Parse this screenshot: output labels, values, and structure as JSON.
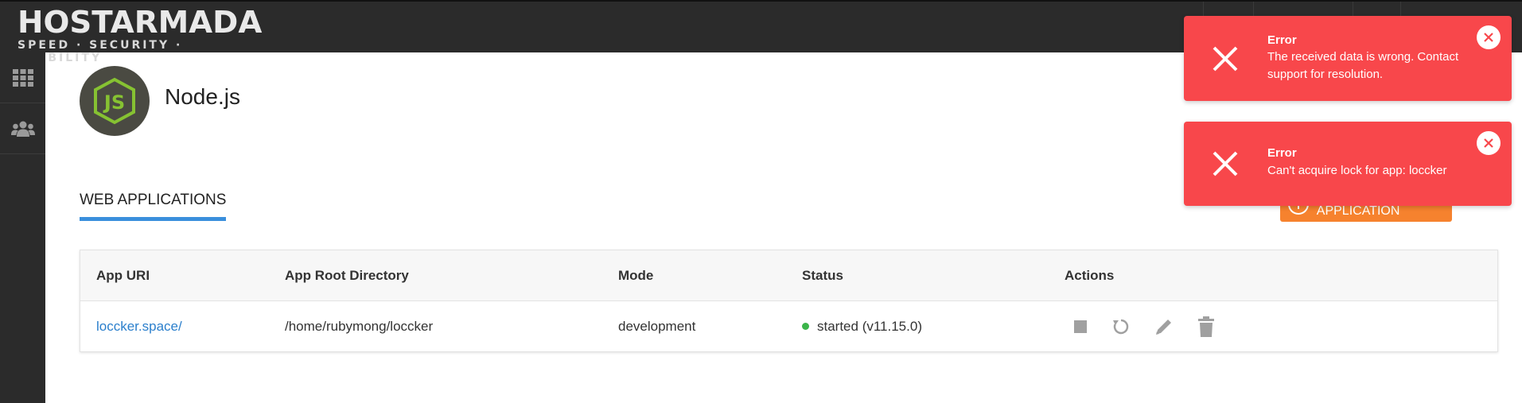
{
  "header": {
    "logo_main": "HOSTARMADA",
    "logo_sub": "SPEED · SECURITY · STABILITY"
  },
  "sidebar": {
    "items": [
      {
        "icon": "grid-icon"
      },
      {
        "icon": "users-icon"
      }
    ]
  },
  "app": {
    "title": "Node.js",
    "logo_icon": "nodejs-icon"
  },
  "tabs": {
    "web_applications": "WEB APPLICATIONS"
  },
  "create_button": {
    "label": "CREATE APPLICATION"
  },
  "table": {
    "headers": [
      "App URI",
      "App Root Directory",
      "Mode",
      "Status",
      "Actions"
    ],
    "rows": [
      {
        "uri": "loccker.space/",
        "root": "/home/rubymong/loccker",
        "mode": "development",
        "status": "started (v11.15.0)",
        "actions": [
          "stop-icon",
          "restart-icon",
          "edit-icon",
          "delete-icon"
        ]
      }
    ]
  },
  "toasts": [
    {
      "title": "Error",
      "message": "The received data is wrong. Contact support for resolution."
    },
    {
      "title": "Error",
      "message": "Can't acquire lock for app: loccker"
    }
  ],
  "colors": {
    "topbar": "#2b2b2b",
    "accent_blue": "#3a8fdc",
    "create_orange": "#f6822e",
    "toast_red": "#f8474b",
    "status_green": "#3bb54a",
    "link": "#2b7fcc"
  }
}
